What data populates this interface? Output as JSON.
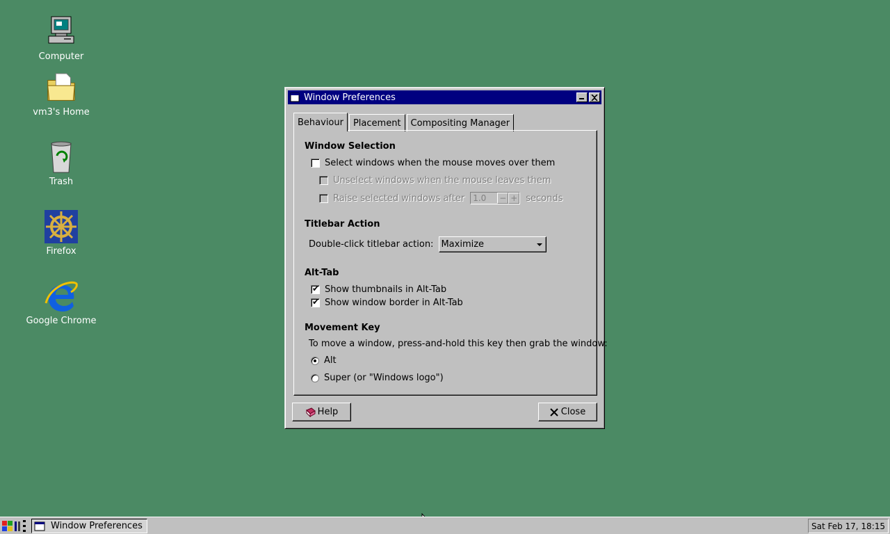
{
  "desktop": {
    "icons": [
      {
        "label": "Computer",
        "icon": "computer-icon"
      },
      {
        "label": "vm3's Home",
        "icon": "folder-icon"
      },
      {
        "label": "Trash",
        "icon": "trash-icon"
      },
      {
        "label": "Firefox",
        "icon": "ship-wheel-icon"
      },
      {
        "label": "Google Chrome",
        "icon": "internet-explorer-icon"
      }
    ]
  },
  "window": {
    "title": "Window Preferences",
    "tabs": [
      {
        "label": "Behaviour",
        "active": true
      },
      {
        "label": "Placement",
        "active": false
      },
      {
        "label": "Compositing Manager",
        "active": false
      }
    ],
    "window_selection": {
      "title": "Window Selection",
      "select_on_hover": {
        "label": "Select windows when the mouse moves over them",
        "checked": false
      },
      "unselect_on_leave": {
        "label": "Unselect windows when the mouse leaves them",
        "checked": false,
        "enabled": false
      },
      "raise_after": {
        "label": "Raise selected windows after",
        "checked": false,
        "enabled": false,
        "value": "1.0",
        "unit": "seconds"
      }
    },
    "titlebar_action": {
      "title": "Titlebar Action",
      "label": "Double-click titlebar action:",
      "selected": "Maximize"
    },
    "alt_tab": {
      "title": "Alt-Tab",
      "thumbnails": {
        "label": "Show thumbnails in Alt-Tab",
        "checked": true
      },
      "border": {
        "label": "Show window border in Alt-Tab",
        "checked": true
      }
    },
    "movement_key": {
      "title": "Movement Key",
      "description": "To move a window, press-and-hold this key then grab the window:",
      "options": [
        {
          "label": "Alt",
          "selected": true
        },
        {
          "label": "Super (or \"Windows logo\")",
          "selected": false
        }
      ]
    },
    "buttons": {
      "help": "Help",
      "close": "Close"
    }
  },
  "taskbar": {
    "task_label": "Window Preferences",
    "clock": "Sat Feb 17, 18:15"
  },
  "colors": {
    "desktop": "#4b8a64",
    "titlebar": "#000080",
    "face": "#c0c0c0"
  }
}
